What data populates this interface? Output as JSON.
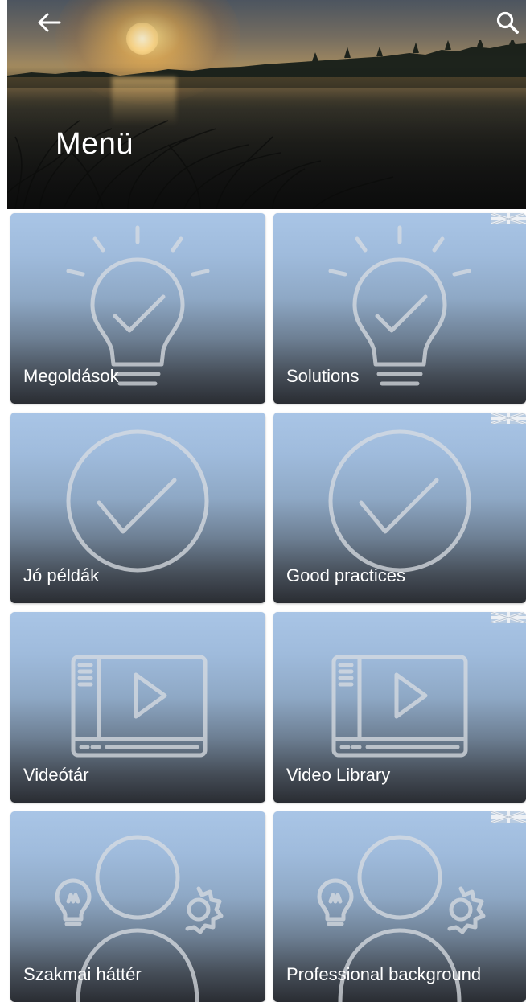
{
  "header": {
    "title": "Menü",
    "back_icon": "arrow-left-icon",
    "search_icon": "search-icon",
    "background": "sunset-lake-photo"
  },
  "tiles": [
    {
      "label": "Megoldások",
      "icon": "lightbulb-check-icon",
      "flag": false
    },
    {
      "label": "Solutions",
      "icon": "lightbulb-check-icon",
      "flag": true
    },
    {
      "label": "Jó példák",
      "icon": "circle-check-icon",
      "flag": false
    },
    {
      "label": "Good practices",
      "icon": "circle-check-icon",
      "flag": true
    },
    {
      "label": "Videótár",
      "icon": "video-player-icon",
      "flag": false
    },
    {
      "label": "Video Library",
      "icon": "video-player-icon",
      "flag": true
    },
    {
      "label": "Szakmai háttér",
      "icon": "person-idea-gear-icon",
      "flag": false
    },
    {
      "label": "Professional background",
      "icon": "person-idea-gear-icon",
      "flag": true
    }
  ],
  "colors": {
    "tile_top": "#a9c5e6",
    "tile_bottom": "#2a2d33",
    "icon_stroke": "#d9dde2",
    "label": "#ffffff"
  }
}
